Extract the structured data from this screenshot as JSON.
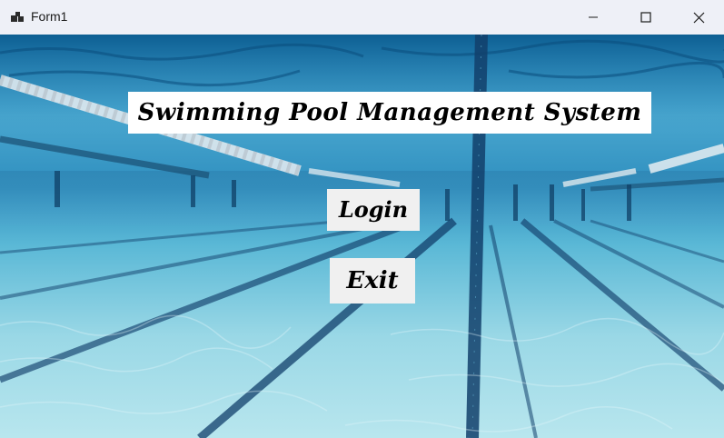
{
  "window": {
    "title": "Form1",
    "controls": {
      "minimize": "minimize-icon",
      "maximize": "maximize-icon",
      "close": "close-icon"
    }
  },
  "main": {
    "title_label": "Swimming Pool Management System",
    "login_button": "Login",
    "exit_button": "Exit"
  },
  "colors": {
    "titlebar_bg": "#eef0f7",
    "water_deep": "#1f6f9e",
    "water_light": "#8fd3e6",
    "lane_line": "#0e3d6b",
    "button_bg": "#f0f0f0"
  }
}
